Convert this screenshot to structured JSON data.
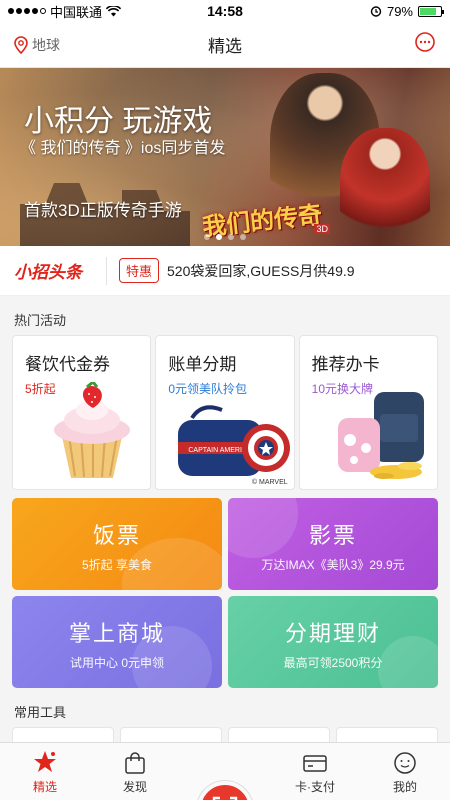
{
  "status_bar": {
    "carrier": "中国联通",
    "time": "14:58",
    "battery_percent": "79%",
    "battery_level": 0.79
  },
  "nav": {
    "location": "地球",
    "title": "精选"
  },
  "banner": {
    "headline": "小积分 玩游戏",
    "subtitle": "《 我们的传奇 》ios同步首发",
    "tagline": "首款3D正版传奇手游",
    "game_logo": "我们的传奇",
    "game_logo_badge": "3D",
    "page_count": 4,
    "active_page": 1
  },
  "headline_row": {
    "brand": "小招头条",
    "tag": "特惠",
    "text": "520袋爱回家,GUESS月供49.9"
  },
  "hot": {
    "section_title": "热门活动",
    "cards": [
      {
        "title": "餐饮代金券",
        "subtitle": "5折起"
      },
      {
        "title": "账单分期",
        "subtitle": "0元领美队拎包",
        "image_text": "CAPTAIN AMERICA",
        "footnote": "© MARVEL"
      },
      {
        "title": "推荐办卡",
        "subtitle": "10元换大牌"
      }
    ]
  },
  "tiles": [
    {
      "title": "饭票",
      "subtitle": "5折起 享美食",
      "color": "#f59a17"
    },
    {
      "title": "影票",
      "subtitle": "万达IMAX《美队3》29.9元",
      "color": "#b553dc"
    },
    {
      "title": "掌上商城",
      "subtitle": "试用中心  0元申领",
      "color": "#857ae8"
    },
    {
      "title": "分期理财",
      "subtitle": "最高可领2500积分",
      "color": "#5bc89d"
    }
  ],
  "tools": {
    "section_title": "常用工具"
  },
  "tabbar": {
    "tabs": [
      {
        "label": "精选"
      },
      {
        "label": "发现"
      },
      {
        "label": "卡·支付"
      },
      {
        "label": "我的"
      }
    ],
    "accent": "#e0251b"
  }
}
